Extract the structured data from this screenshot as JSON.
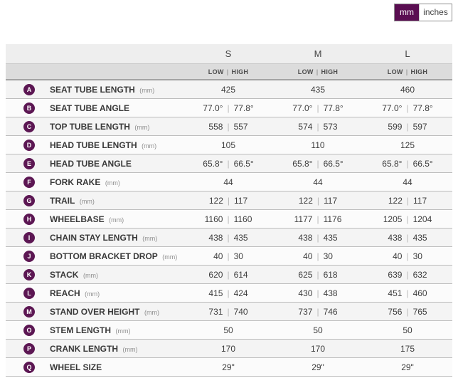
{
  "colors": {
    "accent_purple": "#5a0e52",
    "badge_purple": "#5c1753",
    "header_bg": "#eeeeee",
    "subheader_bg": "#dcdcdc"
  },
  "toggle": {
    "mm_label": "mm",
    "inches_label": "inches",
    "selected": "mm"
  },
  "table": {
    "sizes": [
      "S",
      "M",
      "L"
    ],
    "low_label": "LOW",
    "high_label": "HIGH",
    "value_separator": "|",
    "rows": [
      {
        "letter": "A",
        "label": "SEAT TUBE LENGTH",
        "unit": "(mm)",
        "values": [
          [
            "425"
          ],
          [
            "435"
          ],
          [
            "460"
          ]
        ]
      },
      {
        "letter": "B",
        "label": "SEAT TUBE ANGLE",
        "unit": "",
        "values": [
          [
            "77.0°",
            "77.8°"
          ],
          [
            "77.0°",
            "77.8°"
          ],
          [
            "77.0°",
            "77.8°"
          ]
        ]
      },
      {
        "letter": "C",
        "label": "TOP TUBE LENGTH",
        "unit": "(mm)",
        "values": [
          [
            "558",
            "557"
          ],
          [
            "574",
            "573"
          ],
          [
            "599",
            "597"
          ]
        ]
      },
      {
        "letter": "D",
        "label": "HEAD TUBE LENGTH",
        "unit": "(mm)",
        "values": [
          [
            "105"
          ],
          [
            "110"
          ],
          [
            "125"
          ]
        ]
      },
      {
        "letter": "E",
        "label": "HEAD TUBE ANGLE",
        "unit": "",
        "values": [
          [
            "65.8°",
            "66.5°"
          ],
          [
            "65.8°",
            "66.5°"
          ],
          [
            "65.8°",
            "66.5°"
          ]
        ]
      },
      {
        "letter": "F",
        "label": "FORK RAKE",
        "unit": "(mm)",
        "values": [
          [
            "44"
          ],
          [
            "44"
          ],
          [
            "44"
          ]
        ]
      },
      {
        "letter": "G",
        "label": "TRAIL",
        "unit": "(mm)",
        "values": [
          [
            "122",
            "117"
          ],
          [
            "122",
            "117"
          ],
          [
            "122",
            "117"
          ]
        ]
      },
      {
        "letter": "H",
        "label": "WHEELBASE",
        "unit": "(mm)",
        "values": [
          [
            "1160",
            "1160"
          ],
          [
            "1177",
            "1176"
          ],
          [
            "1205",
            "1204"
          ]
        ]
      },
      {
        "letter": "I",
        "label": "CHAIN STAY LENGTH",
        "unit": "(mm)",
        "values": [
          [
            "438",
            "435"
          ],
          [
            "438",
            "435"
          ],
          [
            "438",
            "435"
          ]
        ]
      },
      {
        "letter": "J",
        "label": "BOTTOM BRACKET DROP",
        "unit": "(mm)",
        "values": [
          [
            "40",
            "30"
          ],
          [
            "40",
            "30"
          ],
          [
            "40",
            "30"
          ]
        ]
      },
      {
        "letter": "K",
        "label": "STACK",
        "unit": "(mm)",
        "values": [
          [
            "620",
            "614"
          ],
          [
            "625",
            "618"
          ],
          [
            "639",
            "632"
          ]
        ]
      },
      {
        "letter": "L",
        "label": "REACH",
        "unit": "(mm)",
        "values": [
          [
            "415",
            "424"
          ],
          [
            "430",
            "438"
          ],
          [
            "451",
            "460"
          ]
        ]
      },
      {
        "letter": "M",
        "label": "STAND OVER HEIGHT",
        "unit": "(mm)",
        "values": [
          [
            "731",
            "740"
          ],
          [
            "737",
            "746"
          ],
          [
            "756",
            "765"
          ]
        ]
      },
      {
        "letter": "O",
        "label": "STEM LENGTH",
        "unit": "(mm)",
        "values": [
          [
            "50"
          ],
          [
            "50"
          ],
          [
            "50"
          ]
        ]
      },
      {
        "letter": "P",
        "label": "CRANK LENGTH",
        "unit": "(mm)",
        "values": [
          [
            "170"
          ],
          [
            "170"
          ],
          [
            "175"
          ]
        ]
      },
      {
        "letter": "Q",
        "label": "WHEEL SIZE",
        "unit": "",
        "values": [
          [
            "29\""
          ],
          [
            "29\""
          ],
          [
            "29\""
          ]
        ]
      }
    ]
  }
}
